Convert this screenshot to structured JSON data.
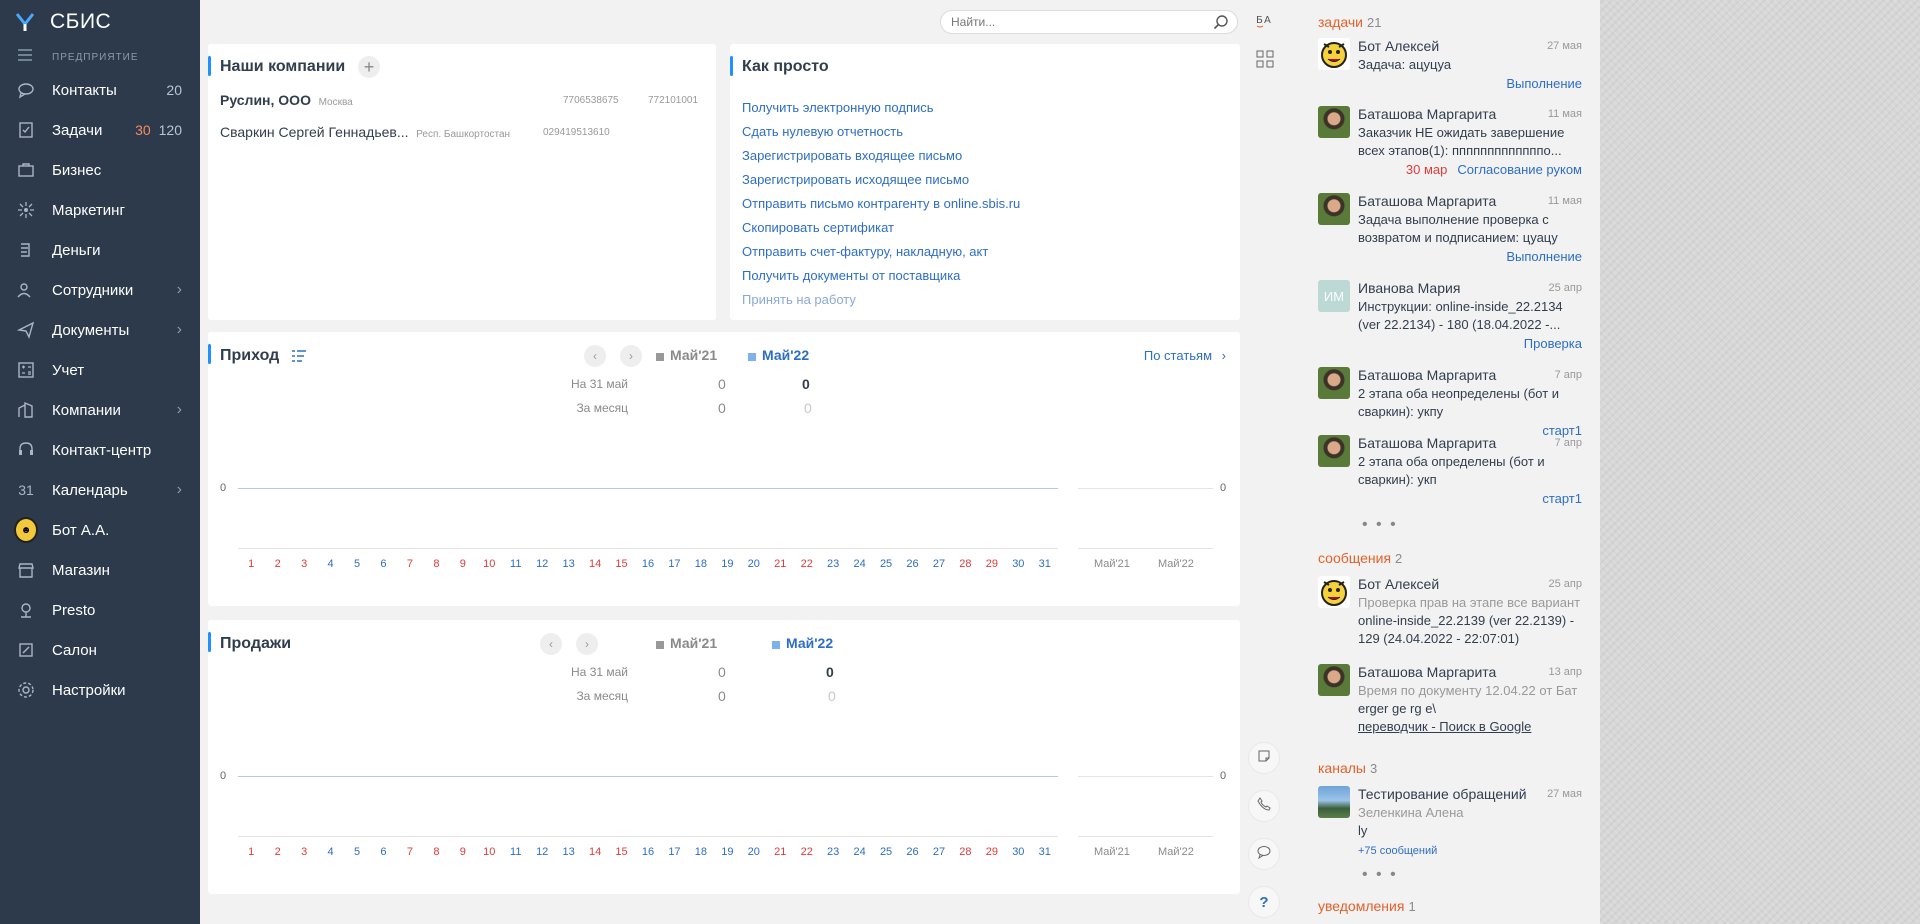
{
  "sidebar": {
    "logo": "СБИС",
    "org": "ПРЕДПРИЯТИЕ",
    "items": [
      {
        "label": "Контакты",
        "icon": "chat-icon",
        "count": "20"
      },
      {
        "label": "Задачи",
        "icon": "tasks-icon",
        "count_red": "30",
        "count": "120"
      },
      {
        "label": "Бизнес",
        "icon": "business-icon"
      },
      {
        "label": "Маркетинг",
        "icon": "marketing-icon"
      },
      {
        "label": "Деньги",
        "icon": "money-icon"
      },
      {
        "label": "Сотрудники",
        "icon": "employees-icon",
        "chevron": true
      },
      {
        "label": "Документы",
        "icon": "documents-icon",
        "chevron": true
      },
      {
        "label": "Учет",
        "icon": "accounting-icon"
      },
      {
        "label": "Компании",
        "icon": "companies-icon",
        "chevron": true
      },
      {
        "label": "Контакт-центр",
        "icon": "headset-icon"
      },
      {
        "label": "Календарь",
        "icon": "calendar-icon",
        "icon_text": "31",
        "chevron": true
      },
      {
        "label": "Бот А.А.",
        "icon": "avatar"
      },
      {
        "label": "Магазин",
        "icon": "shop-icon"
      },
      {
        "label": "Presto",
        "icon": "presto-icon"
      },
      {
        "label": "Салон",
        "icon": "salon-icon"
      },
      {
        "label": "Настройки",
        "icon": "settings-icon"
      }
    ]
  },
  "search": {
    "placeholder": "Найти..."
  },
  "companies": {
    "title": "Наши компании",
    "rows": [
      {
        "name": "Руслин, ООО",
        "city": "Москва",
        "inn": "7706538675",
        "kpp": "772101001"
      },
      {
        "name": "Сваркин Сергей Геннадьев...",
        "city": "Респ. Башкортостан",
        "inn": "029419513610",
        "kpp": ""
      }
    ]
  },
  "easy": {
    "title": "Как просто",
    "links": [
      "Получить электронную подпись",
      "Сдать нулевую отчетность",
      "Зарегистрировать входящее письмо",
      "Зарегистрировать исходящее письмо",
      "Отправить письмо контрагенту в online.sbis.ru",
      "Скопировать сертификат",
      "Отправить счет-фактуру, накладную, акт",
      "Получить документы от поставщика",
      "Принять на работу"
    ]
  },
  "income": {
    "title": "Приход",
    "by_articles": "По статьям",
    "prev": "Май'21",
    "cur": "Май'22",
    "row1_label": "На 31 май",
    "row1_prev": "0",
    "row1_cur": "0",
    "row2_label": "За месяц",
    "row2_prev": "0",
    "row2_cur": "0",
    "zero_left": "0",
    "zero_right": "0"
  },
  "sales": {
    "title": "Продажи",
    "prev": "Май'21",
    "cur": "Май'22",
    "row1_label": "На 31 май",
    "row1_prev": "0",
    "row1_cur": "0",
    "row2_label": "За месяц",
    "row2_prev": "0",
    "row2_cur": "0",
    "zero_left": "0",
    "zero_right": "0"
  },
  "days": [
    "1",
    "2",
    "3",
    "4",
    "5",
    "6",
    "7",
    "8",
    "9",
    "10",
    "11",
    "12",
    "13",
    "14",
    "15",
    "16",
    "17",
    "18",
    "19",
    "20",
    "21",
    "22",
    "23",
    "24",
    "25",
    "26",
    "27",
    "28",
    "29",
    "30",
    "31"
  ],
  "red_days": [
    "1",
    "2",
    "3",
    "7",
    "8",
    "9",
    "10",
    "14",
    "15",
    "21",
    "22",
    "28",
    "29"
  ],
  "months": [
    "Май'21",
    "Май'22"
  ],
  "rpanel": {
    "tasks_label": "задачи",
    "tasks_count": "21",
    "tasks": [
      {
        "name": "Бот Алексей",
        "date": "27 мая",
        "text": "Задача: ацуцуа",
        "status": "Выполнение",
        "avatar": "bot"
      },
      {
        "name": "Баташова Маргарита",
        "date": "11 мая",
        "text": "Заказчик НЕ ожидать завершение всех этапов(1): пппппппппппппо...",
        "status_red": "30 мар",
        "status": "Согласование руком",
        "avatar": "photo"
      },
      {
        "name": "Баташова Маргарита",
        "date": "11 мая",
        "text": "Задача выполнение проверка с возвратом и подписанием: цуацу",
        "status": "Выполнение",
        "avatar": "photo"
      },
      {
        "name": "Иванова Мария",
        "date": "25 апр",
        "text": "Инструкции: online-inside_22.2134 (ver 22.2134) - 180 (18.04.2022 -...",
        "status": "Проверка",
        "avatar": "initials",
        "initials": "ИМ"
      },
      {
        "name": "Баташова Маргарита",
        "date": "7 апр",
        "text": "2 этапа оба неопределены (бот и сваркин): укпу",
        "status": "старт1",
        "avatar": "photo"
      },
      {
        "name": "Баташова Маргарита",
        "date": "7 апр",
        "text": "2 этапа оба определены (бот и сваркин): укп",
        "status": "старт1",
        "avatar": "photo"
      }
    ],
    "messages_label": "сообщения",
    "messages_count": "2",
    "messages": [
      {
        "name": "Бот Алексей",
        "date": "25 апр",
        "text_grey": "Проверка прав на этапе все вариант",
        "text": "online-inside_22.2139 (ver 22.2139) - 129 (24.04.2022 - 22:07:01)",
        "avatar": "bot"
      },
      {
        "name": "Баташова Маргарита",
        "date": "13 апр",
        "text_grey": "Время по документу 12.04.22 от Бат",
        "text": "erger ge rg e\\",
        "link": "переводчик - Поиск в Google",
        "avatar": "photo"
      }
    ],
    "channels_label": "каналы",
    "channels_count": "3",
    "channel": {
      "name": "Тестирование обращений",
      "date": "27 мая",
      "author": "Зеленкина Алена",
      "text": "ly",
      "more": "+75 сообщений"
    },
    "notify_label": "уведомления",
    "notify_count": "1"
  }
}
